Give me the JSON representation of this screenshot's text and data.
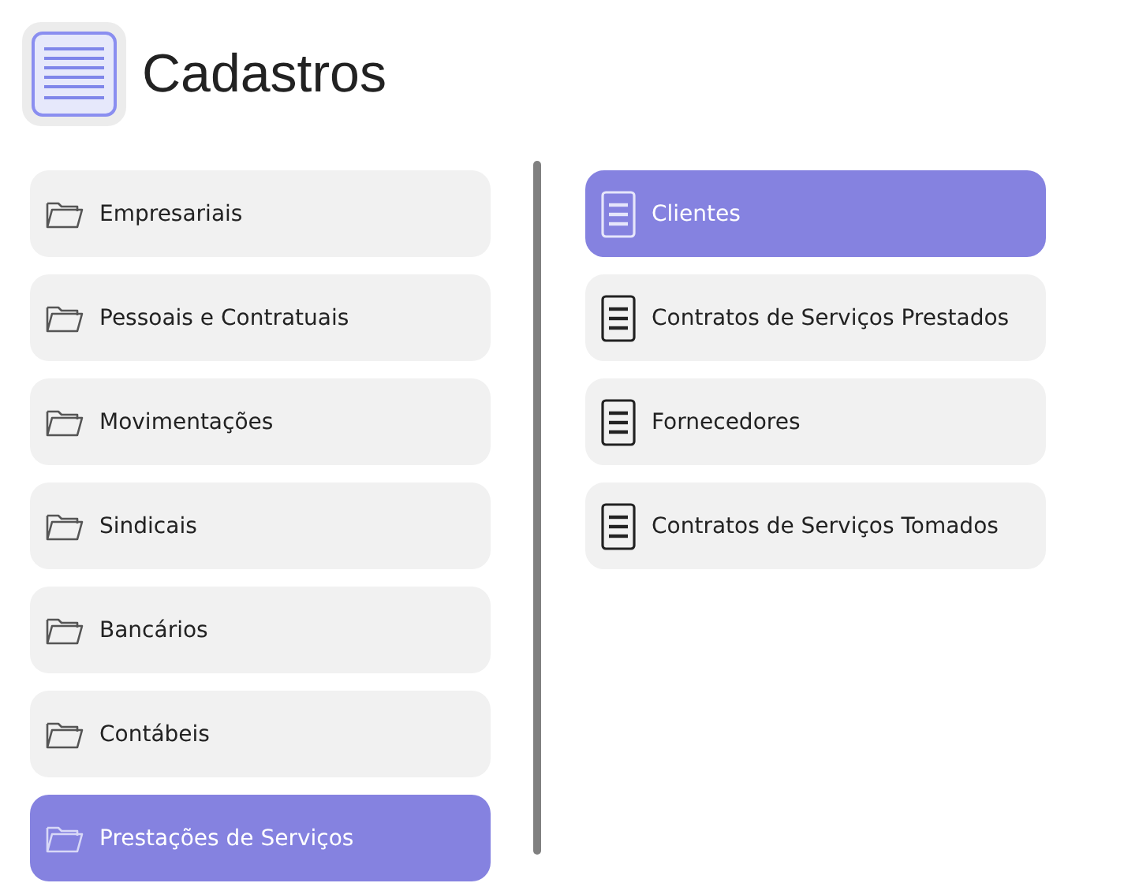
{
  "header": {
    "title": "Cadastros"
  },
  "categories": [
    {
      "label": "Empresariais",
      "selected": false
    },
    {
      "label": "Pessoais e Contratuais",
      "selected": false
    },
    {
      "label": "Movimentações",
      "selected": false
    },
    {
      "label": "Sindicais",
      "selected": false
    },
    {
      "label": "Bancários",
      "selected": false
    },
    {
      "label": "Contábeis",
      "selected": false
    },
    {
      "label": "Prestações de Serviços",
      "selected": true
    }
  ],
  "entries": [
    {
      "label": "Clientes",
      "selected": true
    },
    {
      "label": "Contratos de Serviços Prestados",
      "selected": false
    },
    {
      "label": "Fornecedores",
      "selected": false
    },
    {
      "label": "Contratos de Serviços Tomados",
      "selected": false
    }
  ]
}
